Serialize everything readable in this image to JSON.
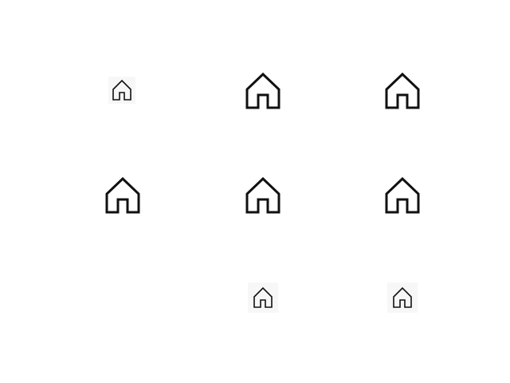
{
  "icons": [
    {
      "name": "home-icon",
      "row": 1,
      "col": 1,
      "size": "small"
    },
    {
      "name": "home-icon",
      "row": 1,
      "col": 2,
      "size": "large"
    },
    {
      "name": "home-icon",
      "row": 1,
      "col": 3,
      "size": "large"
    },
    {
      "name": "home-icon",
      "row": 2,
      "col": 1,
      "size": "large"
    },
    {
      "name": "home-icon",
      "row": 2,
      "col": 2,
      "size": "large"
    },
    {
      "name": "home-icon",
      "row": 2,
      "col": 3,
      "size": "large"
    },
    {
      "name": "home-icon",
      "row": 3,
      "col": 2,
      "size": "small"
    },
    {
      "name": "home-icon",
      "row": 3,
      "col": 3,
      "size": "small"
    }
  ],
  "colors": {
    "background": "#ffffff",
    "icon_stroke": "#111111"
  }
}
